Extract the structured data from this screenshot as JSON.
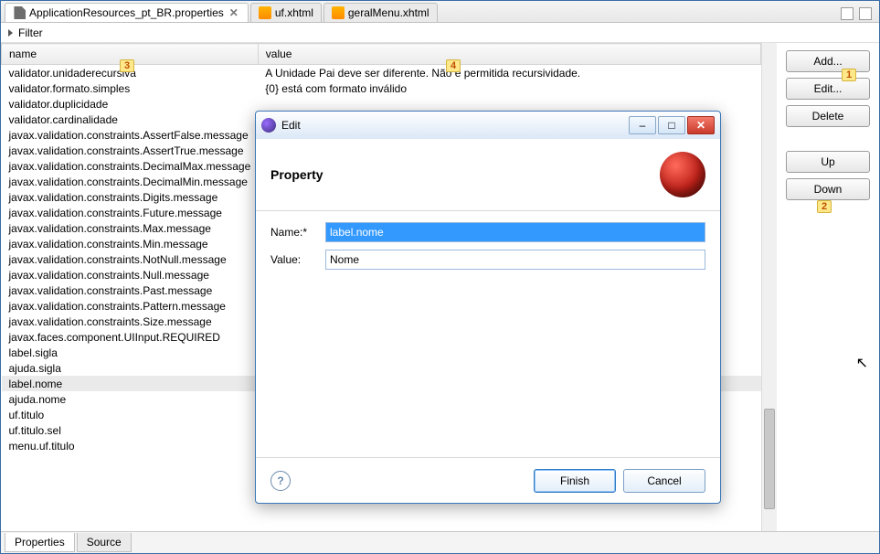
{
  "tabs": [
    {
      "label": "ApplicationResources_pt_BR.properties",
      "icon": "file",
      "active": true
    },
    {
      "label": "uf.xhtml",
      "icon": "xhtml",
      "active": false
    },
    {
      "label": "geralMenu.xhtml",
      "icon": "xhtml",
      "active": false
    }
  ],
  "filter": {
    "label": "Filter"
  },
  "columns": {
    "name": "name",
    "value": "value"
  },
  "rows": [
    {
      "name": "validator.unidaderecursiva",
      "value": "A Unidade Pai deve ser diferente. Não é permitida recursividade."
    },
    {
      "name": "validator.formato.simples",
      "value": "{0} está com formato inválido"
    },
    {
      "name": "validator.duplicidade",
      "value": ""
    },
    {
      "name": "validator.cardinalidade",
      "value": ""
    },
    {
      "name": "javax.validation.constraints.AssertFalse.message",
      "value": ""
    },
    {
      "name": "javax.validation.constraints.AssertTrue.message",
      "value": ""
    },
    {
      "name": "javax.validation.constraints.DecimalMax.message",
      "value": ""
    },
    {
      "name": "javax.validation.constraints.DecimalMin.message",
      "value": ""
    },
    {
      "name": "javax.validation.constraints.Digits.message",
      "value": "})."
    },
    {
      "name": "javax.validation.constraints.Future.message",
      "value": ""
    },
    {
      "name": "javax.validation.constraints.Max.message",
      "value": ""
    },
    {
      "name": "javax.validation.constraints.Min.message",
      "value": ""
    },
    {
      "name": "javax.validation.constraints.NotNull.message",
      "value": ""
    },
    {
      "name": "javax.validation.constraints.Null.message",
      "value": ""
    },
    {
      "name": "javax.validation.constraints.Past.message",
      "value": ""
    },
    {
      "name": "javax.validation.constraints.Pattern.message",
      "value": ""
    },
    {
      "name": "javax.validation.constraints.Size.message",
      "value": ""
    },
    {
      "name": "javax.faces.component.UIInput.REQUIRED",
      "value": ""
    },
    {
      "name": "label.sigla",
      "value": ""
    },
    {
      "name": "ajuda.sigla",
      "value": ""
    },
    {
      "name": "label.nome",
      "value": "",
      "selected": true
    },
    {
      "name": "ajuda.nome",
      "value": ""
    },
    {
      "name": "uf.titulo",
      "value": ""
    },
    {
      "name": "uf.titulo.sel",
      "value": ""
    },
    {
      "name": "menu.uf.titulo",
      "value": ""
    }
  ],
  "sidebar": {
    "add": "Add...",
    "edit": "Edit...",
    "delete": "Delete",
    "up": "Up",
    "down": "Down"
  },
  "callouts": {
    "c1": "1",
    "c2": "2",
    "c3": "3",
    "c4": "4"
  },
  "bottom": {
    "properties": "Properties",
    "source": "Source"
  },
  "dialog": {
    "title": "Edit",
    "heading": "Property",
    "name_label": "Name:*",
    "name_value": "label.nome",
    "value_label": "Value:",
    "value_value": "Nome",
    "finish": "Finish",
    "cancel": "Cancel",
    "help": "?"
  }
}
